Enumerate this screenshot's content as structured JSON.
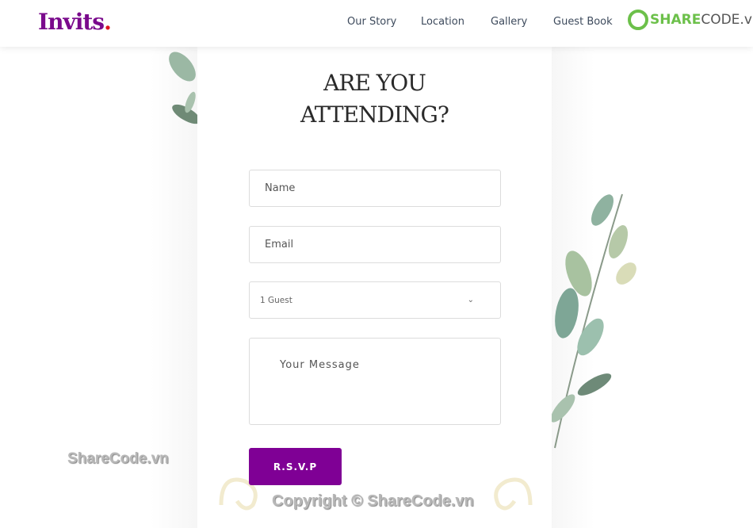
{
  "header": {
    "logo": "Invits",
    "logo_dot": ".",
    "nav": [
      "Our Story",
      "Location",
      "Gallery",
      "Guest Book"
    ],
    "brand_a": "SHARE",
    "brand_b": "CODE.vn"
  },
  "form": {
    "title_line1": "ARE YOU",
    "title_line2": "ATTENDING?",
    "name_placeholder": "Name",
    "email_placeholder": "Email",
    "guests_value": "1 Guest",
    "message_placeholder": "Your Message",
    "submit_label": "R.S.V.P"
  },
  "watermarks": {
    "side": "ShareCode.vn",
    "copyright": "Copyright © ShareCode.vn"
  },
  "colors": {
    "accent": "#7f0095",
    "logo_dot": "#e0161e"
  }
}
